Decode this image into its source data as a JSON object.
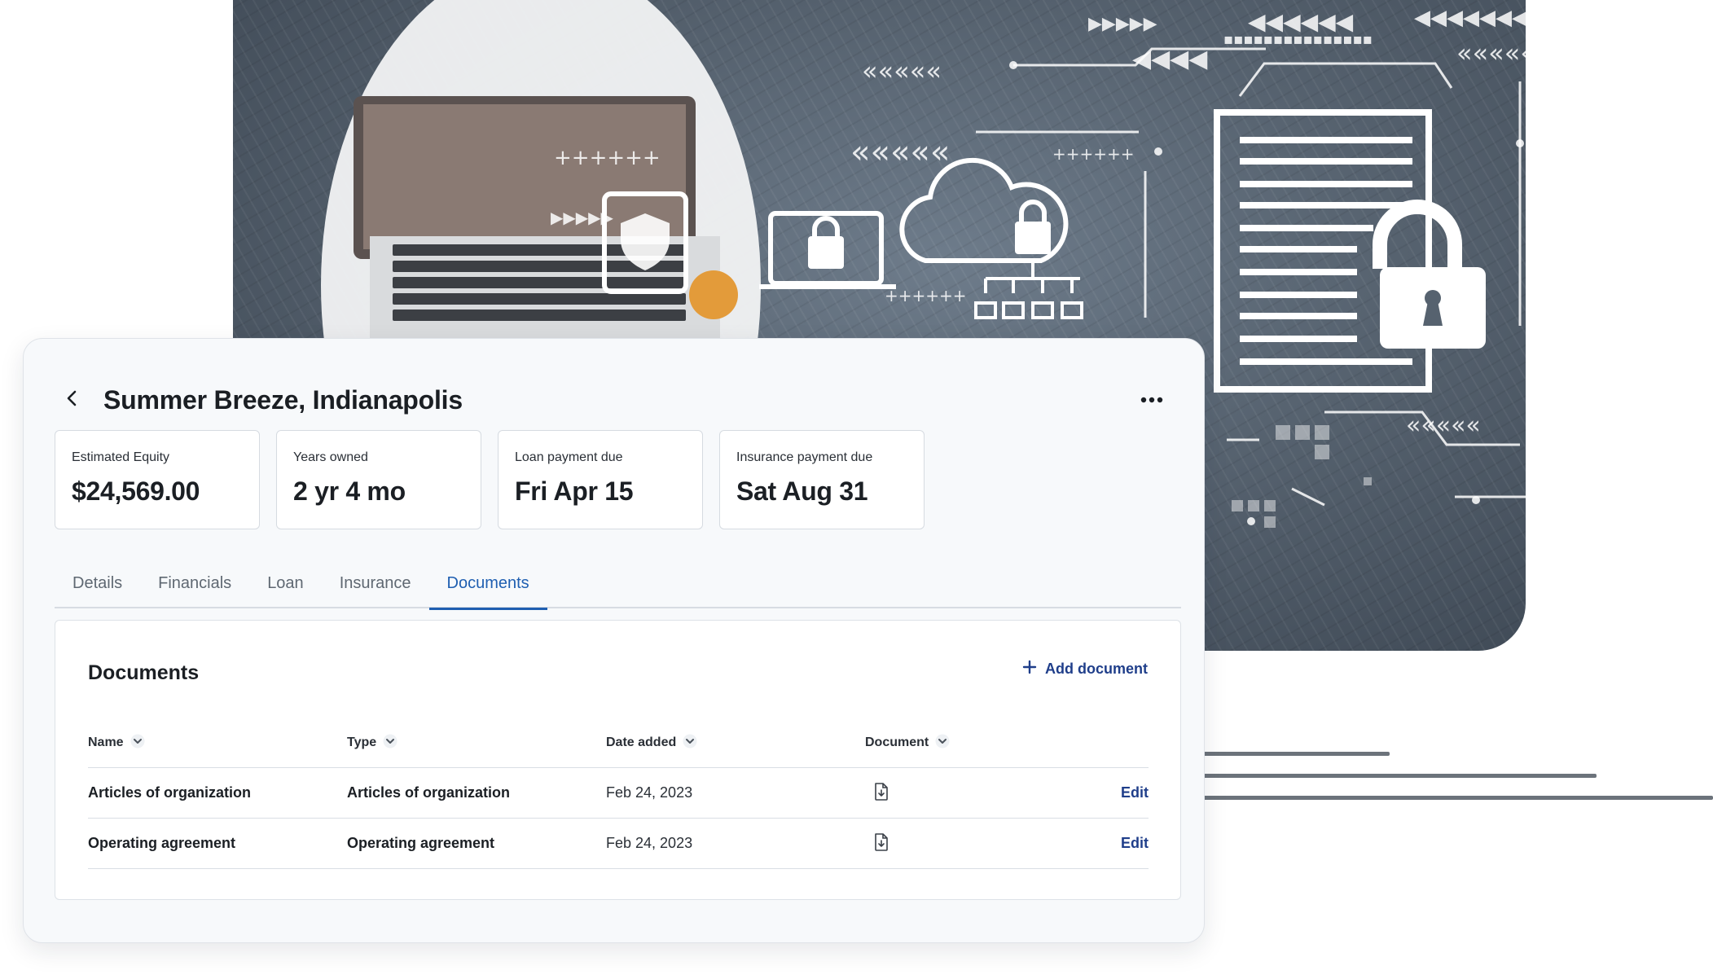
{
  "property": {
    "title": "Summer Breeze, Indianapolis"
  },
  "stats": [
    {
      "label": "Estimated Equity",
      "value": "$24,569.00"
    },
    {
      "label": "Years owned",
      "value": "2 yr 4 mo"
    },
    {
      "label": "Loan payment due",
      "value": "Fri Apr 15"
    },
    {
      "label": "Insurance payment due",
      "value": "Sat Aug 31"
    }
  ],
  "tabs": [
    {
      "label": "Details"
    },
    {
      "label": "Financials"
    },
    {
      "label": "Loan"
    },
    {
      "label": "Insurance"
    },
    {
      "label": "Documents",
      "active": true
    }
  ],
  "documents": {
    "title": "Documents",
    "add_label": "Add document",
    "columns": {
      "name": "Name",
      "type": "Type",
      "date": "Date added",
      "document": "Document"
    },
    "rows": [
      {
        "name": "Articles of organization",
        "type": "Articles of organization",
        "date": "Feb 24, 2023",
        "action": "Edit"
      },
      {
        "name": "Operating agreement",
        "type": "Operating agreement",
        "date": "Feb 24, 2023",
        "action": "Edit"
      }
    ]
  },
  "icons": {
    "back": "chevron-left-icon",
    "more": "more-horizontal-icon",
    "add": "plus-icon",
    "sort": "chevron-down-icon",
    "document": "file-download-icon"
  },
  "colors": {
    "accent": "#1f5fb1",
    "link": "#1f3e8a",
    "card_bg": "#f7f9fb"
  }
}
